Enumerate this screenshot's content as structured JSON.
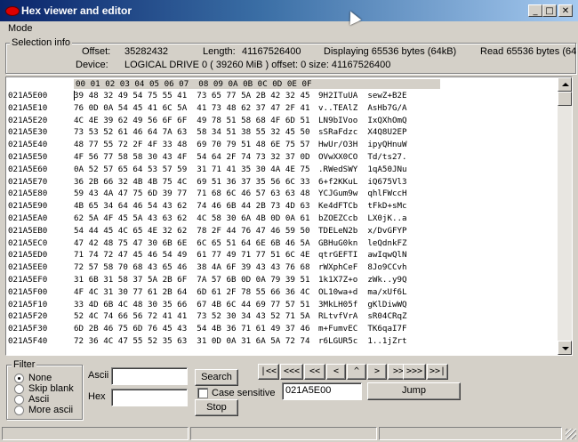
{
  "window": {
    "title": "Hex viewer and editor",
    "minimize": "_",
    "maximize": "□",
    "close": "✕"
  },
  "menu": {
    "mode": "Mode"
  },
  "selection_info": {
    "title": "Selection info",
    "offset_label": "Offset:",
    "offset_value": "35282432",
    "length_label": "Length:",
    "length_value": "41167526400",
    "displaying": "Displaying 65536 bytes (64kB)",
    "read": "Read 65536 bytes (64",
    "device_label": "Device:",
    "device_value": "LOGICAL DRIVE 0  ( 39260 MiB ) offset: 0 size: 41167526400"
  },
  "hex_view": {
    "header": "00 01 02 03 04 05 06 07  08 09 0A 0B 0C 0D 0E 0F",
    "rows": [
      {
        "offset": "021A5E00",
        "hex": "39 48 32 49 54 75 55 41  73 65 77 5A 2B 42 32 45",
        "ascii": "9H2ITuUA  sewZ+B2E"
      },
      {
        "offset": "021A5E10",
        "hex": "76 0D 0A 54 45 41 6C 5A  41 73 48 62 37 47 2F 41",
        "ascii": "v..TEAlZ  AsHb7G/A"
      },
      {
        "offset": "021A5E20",
        "hex": "4C 4E 39 62 49 56 6F 6F  49 78 51 58 68 4F 6D 51",
        "ascii": "LN9bIVoo  IxQXhOmQ"
      },
      {
        "offset": "021A5E30",
        "hex": "73 53 52 61 46 64 7A 63  58 34 51 38 55 32 45 50",
        "ascii": "sSRaFdzc  X4Q8U2EP"
      },
      {
        "offset": "021A5E40",
        "hex": "48 77 55 72 2F 4F 33 48  69 70 79 51 48 6E 75 57",
        "ascii": "HwUr/O3H  ipyQHnuW"
      },
      {
        "offset": "021A5E50",
        "hex": "4F 56 77 58 58 30 43 4F  54 64 2F 74 73 32 37 0D",
        "ascii": "OVwXX0CO  Td/ts27."
      },
      {
        "offset": "021A5E60",
        "hex": "0A 52 57 65 64 53 57 59  31 71 41 35 30 4A 4E 75",
        "ascii": ".RWedSWY  1qA50JNu"
      },
      {
        "offset": "021A5E70",
        "hex": "36 2B 66 32 4B 4B 75 4C  69 51 36 37 35 56 6C 33",
        "ascii": "6+f2KKuL  iQ675Vl3"
      },
      {
        "offset": "021A5E80",
        "hex": "59 43 4A 47 75 6D 39 77  71 68 6C 46 57 63 63 48",
        "ascii": "YCJGum9w  qhlFWccH"
      },
      {
        "offset": "021A5E90",
        "hex": "4B 65 34 64 46 54 43 62  74 46 6B 44 2B 73 4D 63",
        "ascii": "Ke4dFTCb  tFkD+sMc"
      },
      {
        "offset": "021A5EA0",
        "hex": "62 5A 4F 45 5A 43 63 62  4C 58 30 6A 4B 0D 0A 61",
        "ascii": "bZOEZCcb  LX0jK..a"
      },
      {
        "offset": "021A5EB0",
        "hex": "54 44 45 4C 65 4E 32 62  78 2F 44 76 47 46 59 50",
        "ascii": "TDELeN2b  x/DvGFYP"
      },
      {
        "offset": "021A5EC0",
        "hex": "47 42 48 75 47 30 6B 6E  6C 65 51 64 6E 6B 46 5A",
        "ascii": "GBHuG0kn  leQdnkFZ"
      },
      {
        "offset": "021A5ED0",
        "hex": "71 74 72 47 45 46 54 49  61 77 49 71 77 51 6C 4E",
        "ascii": "qtrGEFTI  awIqwQlN"
      },
      {
        "offset": "021A5EE0",
        "hex": "72 57 58 70 68 43 65 46  38 4A 6F 39 43 43 76 68",
        "ascii": "rWXphCeF  8Jo9CCvh"
      },
      {
        "offset": "021A5EF0",
        "hex": "31 6B 31 58 37 5A 2B 6F  7A 57 6B 0D 0A 79 39 51",
        "ascii": "1k1X7Z+o  zWk..y9Q"
      },
      {
        "offset": "021A5F00",
        "hex": "4F 4C 31 30 77 61 2B 64  6D 61 2F 78 55 66 36 4C",
        "ascii": "OL10wa+d  ma/xUf6L"
      },
      {
        "offset": "021A5F10",
        "hex": "33 4D 6B 4C 48 30 35 66  67 4B 6C 44 69 77 57 51",
        "ascii": "3MkLH05f  gKlDiwWQ"
      },
      {
        "offset": "021A5F20",
        "hex": "52 4C 74 66 56 72 41 41  73 52 30 34 43 52 71 5A",
        "ascii": "RLtvfVrA  sR04CRqZ"
      },
      {
        "offset": "021A5F30",
        "hex": "6D 2B 46 75 6D 76 45 43  54 4B 36 71 61 49 37 46",
        "ascii": "m+FumvEC  TK6qaI7F"
      },
      {
        "offset": "021A5F40",
        "hex": "72 36 4C 47 55 52 35 63  31 0D 0A 31 6A 5A 72 74",
        "ascii": "r6LGUR5c  1..1jZrt"
      }
    ]
  },
  "filter": {
    "title": "Filter",
    "options": [
      "None",
      "Skip blank",
      "Ascii",
      "More ascii"
    ],
    "selected": "None"
  },
  "search": {
    "ascii_label": "Ascii",
    "hex_label": "Hex",
    "ascii_value": "",
    "hex_value": "",
    "search_button": "Search",
    "stop_button": "Stop",
    "case_sensitive": "Case sensitive",
    "case_checked": false
  },
  "navigation": {
    "buttons": [
      "|<<",
      "<<<",
      "<<",
      "<",
      "^",
      ">",
      ">>",
      ">>>",
      ">>|"
    ],
    "address": "021A5E00",
    "jump_button": "Jump"
  }
}
